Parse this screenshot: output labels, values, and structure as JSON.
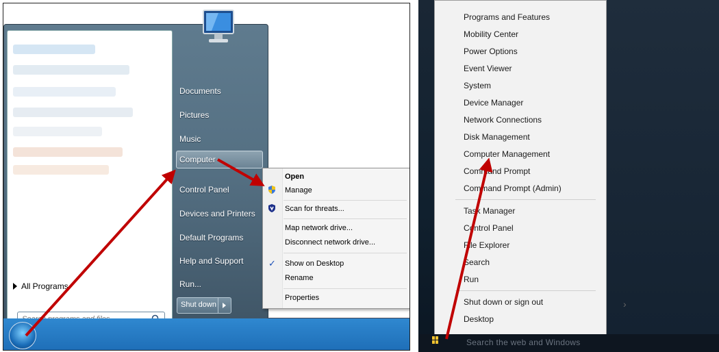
{
  "win7": {
    "start_menu": {
      "right_links": [
        "Documents",
        "Pictures",
        "Music",
        "Computer",
        "Control Panel",
        "Devices and Printers",
        "Default Programs",
        "Help and Support",
        "Run..."
      ],
      "all_programs": "All Programs",
      "search_placeholder": "Search programs and files",
      "shutdown": "Shut down"
    },
    "context_menu": {
      "open": "Open",
      "manage": "Manage",
      "scan": "Scan for threats...",
      "map_drive": "Map network drive...",
      "disconnect_drive": "Disconnect network drive...",
      "show_desktop": "Show on Desktop",
      "rename": "Rename",
      "properties": "Properties",
      "check": "✓"
    }
  },
  "win10": {
    "menu_items": [
      "Programs and Features",
      "Mobility Center",
      "Power Options",
      "Event Viewer",
      "System",
      "Device Manager",
      "Network Connections",
      "Disk Management",
      "Computer Management",
      "Command Prompt",
      "Command Prompt (Admin)",
      "Task Manager",
      "Control Panel",
      "File Explorer",
      "Search",
      "Run",
      "Shut down or sign out",
      "Desktop"
    ],
    "chevron": "›",
    "taskbar_search": "Search the web and Windows"
  },
  "colors": {
    "arrow": "#c00000",
    "w7_taskbar": "#2a7fc8",
    "w10_bg": "#14222f"
  }
}
